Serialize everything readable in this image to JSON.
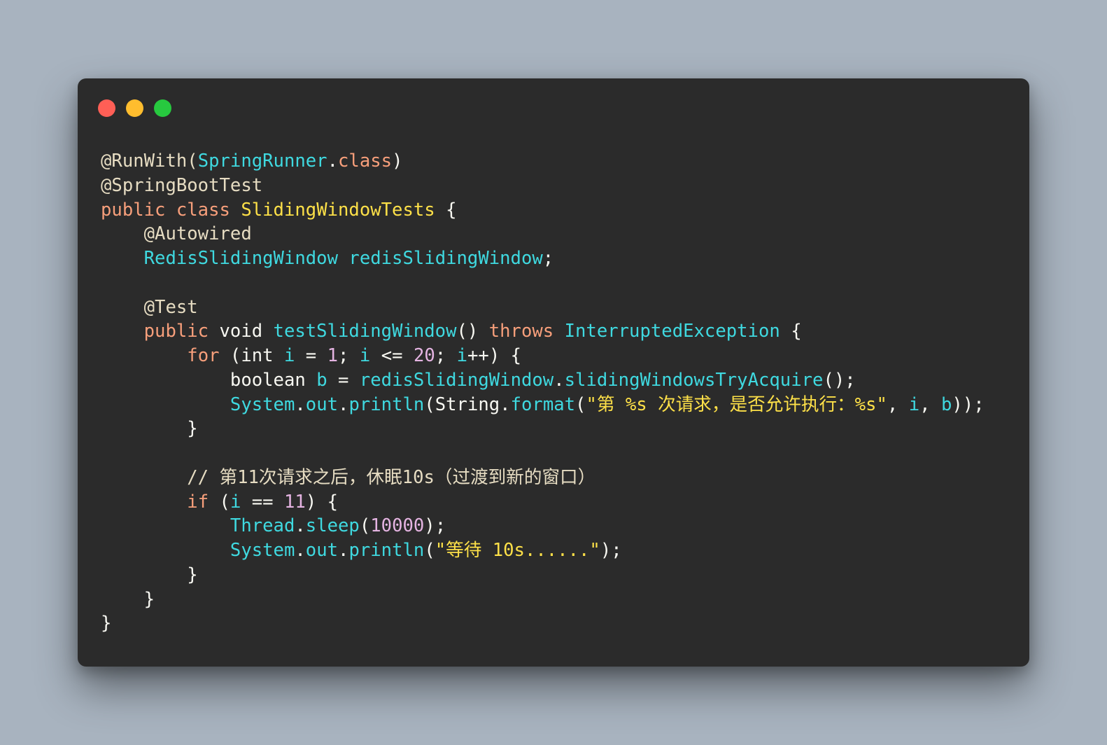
{
  "window": {
    "controls": [
      {
        "name": "close",
        "color": "#ff5f56"
      },
      {
        "name": "minimize",
        "color": "#ffbd2e"
      },
      {
        "name": "maximize",
        "color": "#27c93f"
      }
    ]
  },
  "editor": {
    "language": "java",
    "lines": [
      [
        {
          "t": "@RunWith(",
          "c": "ann"
        },
        {
          "t": "SpringRunner",
          "c": "type"
        },
        {
          "t": ".",
          "c": "plain"
        },
        {
          "t": "class",
          "c": "kw"
        },
        {
          "t": ")",
          "c": "plain"
        }
      ],
      [
        {
          "t": "@SpringBootTest",
          "c": "ann"
        }
      ],
      [
        {
          "t": "public class ",
          "c": "kw"
        },
        {
          "t": "SlidingWindowTests",
          "c": "cls"
        },
        {
          "t": " {",
          "c": "plain"
        }
      ],
      [
        {
          "t": "    @Autowired",
          "c": "ann"
        }
      ],
      [
        {
          "t": "    ",
          "c": "plain"
        },
        {
          "t": "RedisSlidingWindow",
          "c": "type"
        },
        {
          "t": " ",
          "c": "plain"
        },
        {
          "t": "redisSlidingWindow",
          "c": "var"
        },
        {
          "t": ";",
          "c": "plain"
        }
      ],
      [],
      [
        {
          "t": "    @Test",
          "c": "ann"
        }
      ],
      [
        {
          "t": "    ",
          "c": "plain"
        },
        {
          "t": "public",
          "c": "kw"
        },
        {
          "t": " void ",
          "c": "plain"
        },
        {
          "t": "testSlidingWindow",
          "c": "fn"
        },
        {
          "t": "() ",
          "c": "plain"
        },
        {
          "t": "throws",
          "c": "kw"
        },
        {
          "t": " ",
          "c": "plain"
        },
        {
          "t": "InterruptedException",
          "c": "type"
        },
        {
          "t": " {",
          "c": "plain"
        }
      ],
      [
        {
          "t": "        ",
          "c": "plain"
        },
        {
          "t": "for",
          "c": "kw"
        },
        {
          "t": " (int ",
          "c": "plain"
        },
        {
          "t": "i",
          "c": "var"
        },
        {
          "t": " = ",
          "c": "plain"
        },
        {
          "t": "1",
          "c": "num"
        },
        {
          "t": "; ",
          "c": "plain"
        },
        {
          "t": "i",
          "c": "var"
        },
        {
          "t": " <= ",
          "c": "plain"
        },
        {
          "t": "20",
          "c": "num"
        },
        {
          "t": "; ",
          "c": "plain"
        },
        {
          "t": "i",
          "c": "var"
        },
        {
          "t": "++) {",
          "c": "plain"
        }
      ],
      [
        {
          "t": "            boolean ",
          "c": "plain"
        },
        {
          "t": "b",
          "c": "var"
        },
        {
          "t": " = ",
          "c": "plain"
        },
        {
          "t": "redisSlidingWindow",
          "c": "var"
        },
        {
          "t": ".",
          "c": "plain"
        },
        {
          "t": "slidingWindowsTryAcquire",
          "c": "fn"
        },
        {
          "t": "();",
          "c": "plain"
        }
      ],
      [
        {
          "t": "            ",
          "c": "plain"
        },
        {
          "t": "System",
          "c": "type"
        },
        {
          "t": ".",
          "c": "plain"
        },
        {
          "t": "out",
          "c": "var"
        },
        {
          "t": ".",
          "c": "plain"
        },
        {
          "t": "println",
          "c": "fn"
        },
        {
          "t": "(String.",
          "c": "plain"
        },
        {
          "t": "format",
          "c": "fn"
        },
        {
          "t": "(",
          "c": "plain"
        },
        {
          "t": "\"第 %s 次请求，是否允许执行：%s\"",
          "c": "str"
        },
        {
          "t": ", ",
          "c": "plain"
        },
        {
          "t": "i",
          "c": "var"
        },
        {
          "t": ", ",
          "c": "plain"
        },
        {
          "t": "b",
          "c": "var"
        },
        {
          "t": "));",
          "c": "plain"
        }
      ],
      [
        {
          "t": "        }",
          "c": "plain"
        }
      ],
      [],
      [
        {
          "t": "        // 第11次请求之后，休眠10s（过渡到新的窗口）",
          "c": "cmt"
        }
      ],
      [
        {
          "t": "        ",
          "c": "plain"
        },
        {
          "t": "if",
          "c": "kw"
        },
        {
          "t": " (",
          "c": "plain"
        },
        {
          "t": "i",
          "c": "var"
        },
        {
          "t": " == ",
          "c": "plain"
        },
        {
          "t": "11",
          "c": "num"
        },
        {
          "t": ") {",
          "c": "plain"
        }
      ],
      [
        {
          "t": "            ",
          "c": "plain"
        },
        {
          "t": "Thread",
          "c": "type"
        },
        {
          "t": ".",
          "c": "plain"
        },
        {
          "t": "sleep",
          "c": "fn"
        },
        {
          "t": "(",
          "c": "plain"
        },
        {
          "t": "10000",
          "c": "num"
        },
        {
          "t": ");",
          "c": "plain"
        }
      ],
      [
        {
          "t": "            ",
          "c": "plain"
        },
        {
          "t": "System",
          "c": "type"
        },
        {
          "t": ".",
          "c": "plain"
        },
        {
          "t": "out",
          "c": "var"
        },
        {
          "t": ".",
          "c": "plain"
        },
        {
          "t": "println",
          "c": "fn"
        },
        {
          "t": "(",
          "c": "plain"
        },
        {
          "t": "\"等待 10s......\"",
          "c": "str"
        },
        {
          "t": ");",
          "c": "plain"
        }
      ],
      [
        {
          "t": "        }",
          "c": "plain"
        }
      ],
      [
        {
          "t": "    }",
          "c": "plain"
        }
      ],
      [
        {
          "t": "}",
          "c": "plain"
        }
      ]
    ]
  }
}
